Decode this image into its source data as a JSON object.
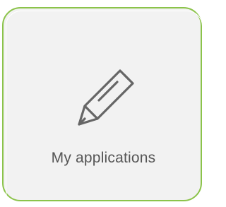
{
  "tile": {
    "label": "My applications",
    "icon": "pencil-icon",
    "colors": {
      "border": "#8bc34a",
      "background": "#f2f2f2",
      "icon": "#666666",
      "text": "#555555"
    }
  }
}
